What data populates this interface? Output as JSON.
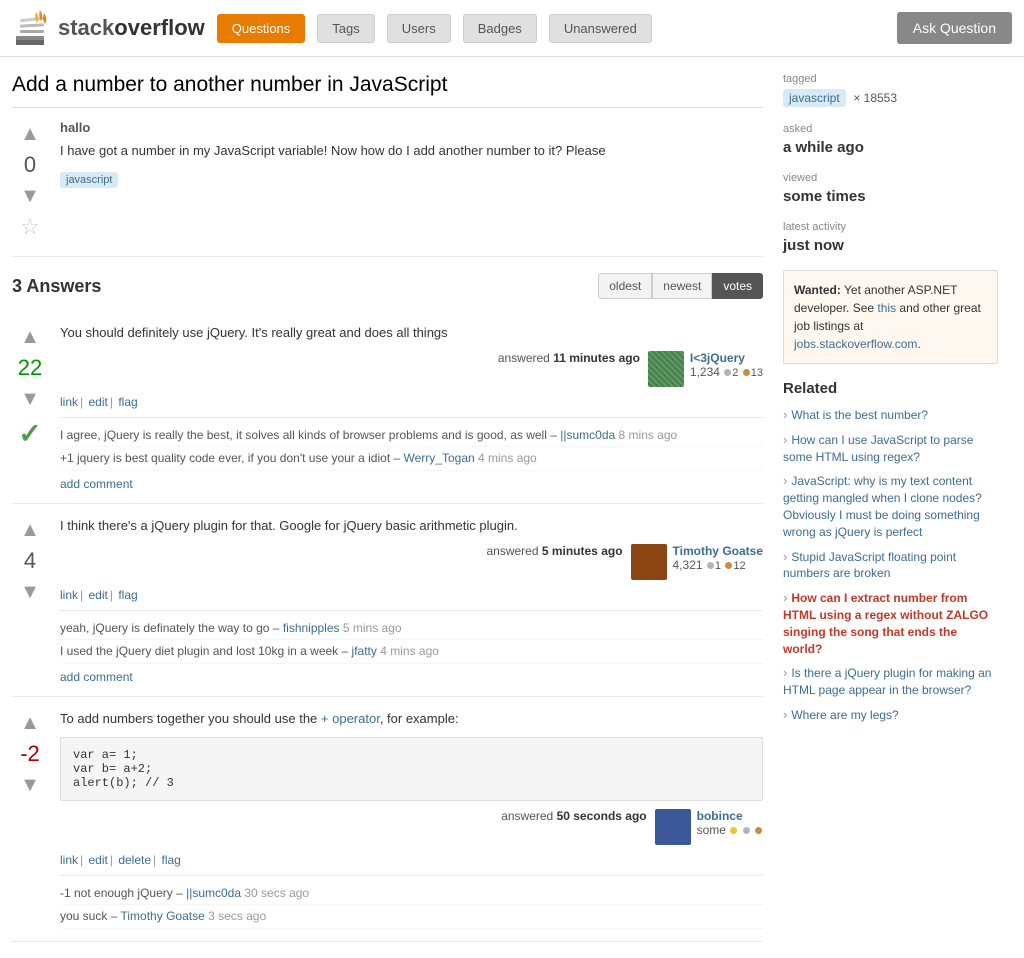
{
  "header": {
    "logo_text": "stackoverflow",
    "nav": [
      "Questions",
      "Tags",
      "Users",
      "Badges",
      "Unanswered"
    ],
    "active_nav": "Questions",
    "ask_button": "Ask Question"
  },
  "question": {
    "title": "Add a number to another number in JavaScript",
    "vote_count": "0",
    "user": "hallo",
    "text": "I have got a number in my JavaScript variable! Now how do I add another number to it? Please",
    "tag": "javascript",
    "star_label": "★"
  },
  "answers": {
    "count_label": "3 Answers",
    "sort": [
      "oldest",
      "newest",
      "votes"
    ],
    "active_sort": "votes",
    "items": [
      {
        "vote_count": "22",
        "accepted": true,
        "text": "You should definitely use jQuery. It's really great and does all things",
        "answered_label": "answered",
        "time": "11 minutes ago",
        "user_name": "I<3jQuery",
        "user_rep": "1,234",
        "rep_silver": 2,
        "rep_bronze": 13,
        "links": [
          "link",
          "edit",
          "flag"
        ],
        "comments": [
          {
            "text": "I agree, jQuery is really the best, it solves all kinds of browser problems and is good, as well –",
            "user": "||sumc0da",
            "time": "8 mins ago"
          },
          {
            "text": "+1 jquery is best quality code ever, if you don't use your a idiot –",
            "user": "Werry_Togan",
            "time": "4 mins ago"
          }
        ],
        "add_comment": "add comment"
      },
      {
        "vote_count": "4",
        "accepted": false,
        "text": "I think there's a jQuery plugin for that. Google for jQuery basic arithmetic plugin.",
        "answered_label": "answered",
        "time": "5 minutes ago",
        "user_name": "Timothy Goatse",
        "user_rep": "4,321",
        "rep_silver": 1,
        "rep_bronze": 12,
        "links": [
          "link",
          "edit",
          "flag"
        ],
        "comments": [
          {
            "text": "yeah, jQuery is definately the way to go –",
            "user": "fishnipples",
            "time": "5 mins ago"
          },
          {
            "text": "I used the jQuery diet plugin and lost 10kg in a week –",
            "user": "jfatty",
            "time": "4 mins ago"
          }
        ],
        "add_comment": "add comment"
      },
      {
        "vote_count": "-2",
        "accepted": false,
        "text": "To add numbers together you should use the + operator, for example:",
        "code": "var a= 1;\nvar b= a+2;\nalert(b);  // 3",
        "answered_label": "answered",
        "time": "50 seconds ago",
        "user_name": "bobince",
        "user_rep": "some",
        "rep_gold": 1,
        "rep_silver": 1,
        "rep_bronze": 1,
        "links": [
          "link",
          "edit",
          "delete",
          "flag"
        ],
        "comments": [
          {
            "text": "-1 not enough jQuery –",
            "user": "||sumc0da",
            "time": "30 secs ago"
          },
          {
            "text": "you suck –",
            "user": "Timothy Goatse",
            "time": "3 secs ago"
          }
        ],
        "add_comment": ""
      }
    ]
  },
  "sidebar": {
    "tagged_label": "tagged",
    "tag": "javascript",
    "tag_count": "× 18553",
    "asked_label": "asked",
    "asked_value": "a while ago",
    "viewed_label": "viewed",
    "viewed_value": "some times",
    "activity_label": "latest activity",
    "activity_value": "just now",
    "ad": {
      "wanted": "Wanted:",
      "text": "Yet another ASP.NET developer. See this and other great job listings at jobs.stackoverflow.com."
    },
    "related_title": "Related",
    "related_links": [
      {
        "text": "What is the best number?",
        "hot": false
      },
      {
        "text": "How can I use JavaScript to parse some HTML using regex?",
        "hot": false
      },
      {
        "text": "JavaScript: why is my text content getting mangled when I clone nodes? Obviously I must be doing something wrong as jQuery is perfect",
        "hot": false
      },
      {
        "text": "Stupid JavaScript floating point numbers are broken",
        "hot": false
      },
      {
        "text": "How can I extract number from HTML using a regex without ZALGO singing the song that ends the world?",
        "hot": true
      },
      {
        "text": "Is there a jQuery plugin for making an HTML page appear in the browser?",
        "hot": false
      },
      {
        "text": "Where are my legs?",
        "hot": false
      }
    ]
  }
}
